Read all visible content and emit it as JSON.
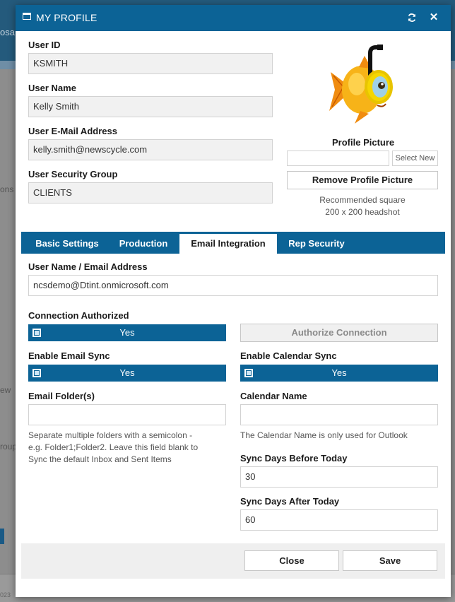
{
  "background": {
    "top_left_text": "osa",
    "left_frag_1": "ons",
    "left_frag_2": "ew",
    "left_frag_3": "roup",
    "bottom_year": "023"
  },
  "dialog": {
    "title": "MY PROFILE",
    "refresh_icon": "refresh-icon",
    "close_icon": "close-icon"
  },
  "profile": {
    "user_id_label": "User ID",
    "user_id_value": "KSMITH",
    "user_name_label": "User Name",
    "user_name_value": "Kelly Smith",
    "email_label": "User E-Mail Address",
    "email_value": "kelly.smith@newscycle.com",
    "security_group_label": "User Security Group",
    "security_group_value": "CLIENTS",
    "picture_label": "Profile Picture",
    "picture_filename": "",
    "select_new_label": "Select New",
    "remove_picture_label": "Remove Profile Picture",
    "recommended_line1": "Recommended square",
    "recommended_line2": "200 x 200 headshot"
  },
  "tabs": [
    {
      "label": "Basic Settings",
      "active": false
    },
    {
      "label": "Production",
      "active": false
    },
    {
      "label": "Email Integration",
      "active": true
    },
    {
      "label": "Rep Security",
      "active": false
    }
  ],
  "email_integration": {
    "username_label": "User Name / Email Address",
    "username_value": "ncsdemo@Dtint.onmicrosoft.com",
    "connection_authorized_label": "Connection Authorized",
    "connection_authorized_value": "Yes",
    "authorize_button_label": "Authorize Connection",
    "enable_email_sync_label": "Enable Email Sync",
    "enable_email_sync_value": "Yes",
    "enable_calendar_sync_label": "Enable Calendar Sync",
    "enable_calendar_sync_value": "Yes",
    "email_folders_label": "Email Folder(s)",
    "email_folders_value": "",
    "email_folders_note_1": "Separate multiple folders with a semicolon -",
    "email_folders_note_2": "e.g. Folder1;Folder2. Leave this field blank to",
    "email_folders_note_3": "Sync the default Inbox and Sent Items",
    "calendar_name_label": "Calendar Name",
    "calendar_name_value": "",
    "calendar_name_note": "The Calendar Name is only used for Outlook",
    "sync_before_label": "Sync Days Before Today",
    "sync_before_value": "30",
    "sync_after_label": "Sync Days After Today",
    "sync_after_value": "60"
  },
  "footer": {
    "close_label": "Close",
    "save_label": "Save"
  },
  "colors": {
    "primary": "#0c6396",
    "field_bg": "#f1f1f1"
  }
}
